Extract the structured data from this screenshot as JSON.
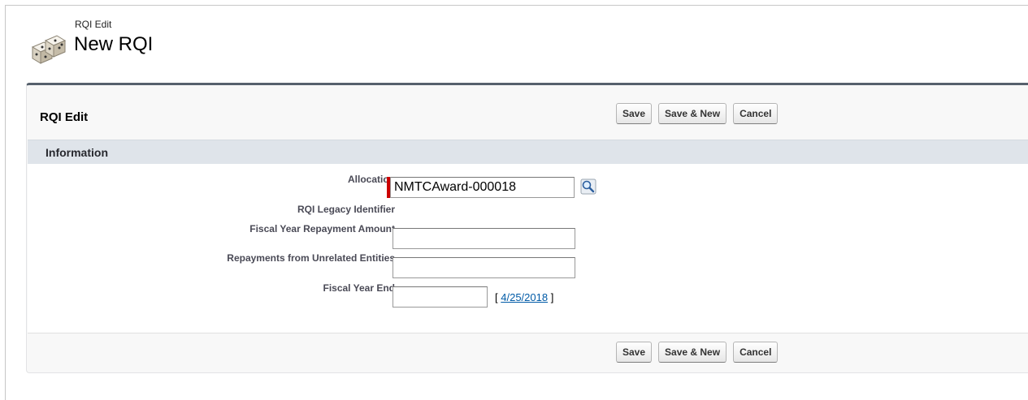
{
  "header": {
    "page_type": "RQI Edit",
    "page_title": "New RQI"
  },
  "block": {
    "title": "RQI Edit",
    "buttons": {
      "save": "Save",
      "save_new": "Save & New",
      "cancel": "Cancel"
    }
  },
  "section": {
    "title": "Information"
  },
  "fields": {
    "allocation": {
      "label": "Allocation",
      "value": "NMTCAward-000018"
    },
    "legacy_identifier": {
      "label": "RQI Legacy Identifier"
    },
    "fy_repayment_amount": {
      "label": "Fiscal Year Repayment Amount",
      "value": ""
    },
    "repayments_unrelated": {
      "label": "Repayments from Unrelated Entities",
      "value": ""
    },
    "fiscal_year_end": {
      "label": "Fiscal Year End",
      "value": "",
      "date_open": "[",
      "today_date": "4/25/2018",
      "date_close": "]"
    }
  },
  "icons": {
    "page_icon": "dice-icon",
    "lookup_icon": "magnifier-icon"
  },
  "colors": {
    "required": "#cc0000",
    "header_bar": "#56606c",
    "section_bg": "#dfe4ea",
    "link": "#015ba7"
  }
}
